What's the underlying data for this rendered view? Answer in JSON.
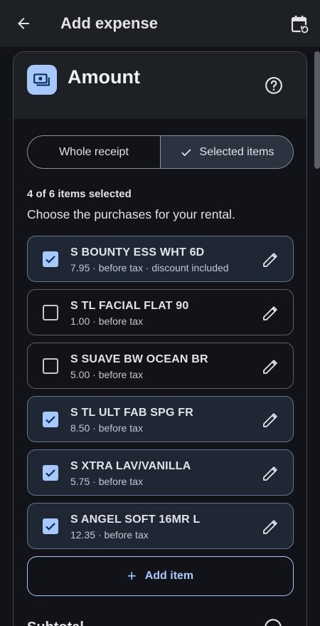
{
  "appbar": {
    "title": "Add expense",
    "back_icon": "arrow-left-icon",
    "calendar_icon": "calendar-sync-icon"
  },
  "amount_card": {
    "heading": "Amount",
    "icon": "money-icon",
    "help_icon": "help-circle-icon",
    "segment": {
      "options": [
        "Whole receipt",
        "Selected items"
      ],
      "selected": "Selected items"
    },
    "selection_count": "4 of 6 items selected",
    "prompt": "Choose the purchases for your rental.",
    "items": [
      {
        "name": "S BOUNTY ESS WHT 6D",
        "meta": "7.95 · before tax · discount included",
        "checked": true
      },
      {
        "name": "S TL FACIAL FLAT 90",
        "meta": "1.00 · before tax",
        "checked": false
      },
      {
        "name": "S SUAVE BW OCEAN BR",
        "meta": "5.00 · before tax",
        "checked": false
      },
      {
        "name": "S TL ULT FAB SPG FR",
        "meta": "8.50 · before tax",
        "checked": true
      },
      {
        "name": "S XTRA LAV/VANILLA",
        "meta": "5.75 · before tax",
        "checked": true
      },
      {
        "name": "S ANGEL SOFT 16MR L",
        "meta": "12.35 · before tax",
        "checked": true
      }
    ],
    "add_item_label": "Add item",
    "next_section_heading": "Subtotal"
  },
  "colors": {
    "accent": "#a8c7fa",
    "background": "#111318",
    "surface": "#1d2024",
    "selected_item": "#1f2634"
  }
}
